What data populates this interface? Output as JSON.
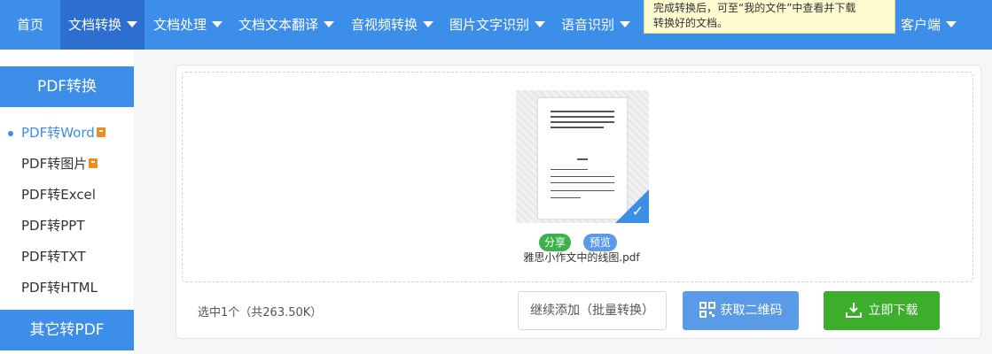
{
  "nav": {
    "items": [
      {
        "label": "首页",
        "caret": false,
        "active": false
      },
      {
        "label": "文档转换",
        "caret": true,
        "active": true
      },
      {
        "label": "文档处理",
        "caret": true,
        "active": false
      },
      {
        "label": "文档文本翻译",
        "caret": true,
        "active": false
      },
      {
        "label": "音视频转换",
        "caret": true,
        "active": false
      },
      {
        "label": "图片文字识别",
        "caret": true,
        "active": false
      },
      {
        "label": "语音识别",
        "caret": true,
        "active": false
      },
      {
        "label": "客户端",
        "caret": true,
        "active": false
      }
    ],
    "tooltip_line1": "完成转换后，可至“我的文件”中查看并下载",
    "tooltip_line2": "转换好的文档。"
  },
  "sidebar": {
    "heading": "PDF转换",
    "items": [
      {
        "label": "PDF转Word",
        "active": true,
        "badge": true
      },
      {
        "label": "PDF转图片",
        "active": false,
        "badge": true
      },
      {
        "label": "PDF转Excel",
        "active": false,
        "badge": false
      },
      {
        "label": "PDF转PPT",
        "active": false,
        "badge": false
      },
      {
        "label": "PDF转TXT",
        "active": false,
        "badge": false
      },
      {
        "label": "PDF转HTML",
        "active": false,
        "badge": false
      }
    ],
    "heading2": "其它转PDF"
  },
  "file": {
    "share_label": "分享",
    "preview_label": "预览",
    "name": "雅思小作文中的线图.pdf"
  },
  "footer": {
    "count_text": "选中1个（共263.50K）",
    "continue_label": "继续添加（批量转换）",
    "qr_label": "获取二维码",
    "download_label": "立即下载"
  },
  "colors": {
    "primary": "#3d8ee8",
    "nav_active": "#2c6fce",
    "green": "#3cae2c",
    "light_blue": "#5a9be8",
    "badge": "#f08a24"
  }
}
